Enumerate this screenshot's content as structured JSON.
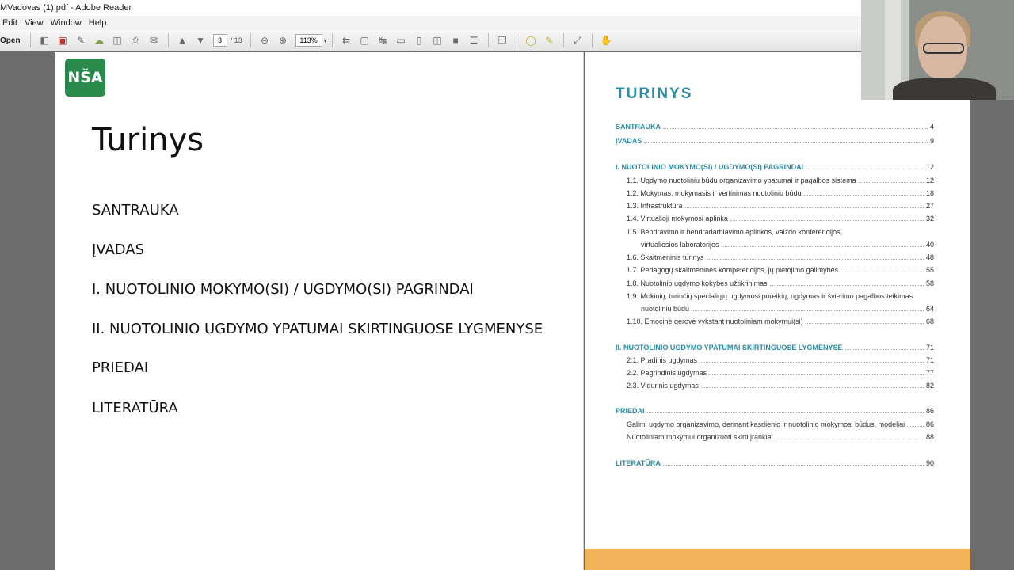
{
  "window": {
    "title": "MVadovas (1).pdf - Adobe Reader"
  },
  "menu": [
    "Edit",
    "View",
    "Window",
    "Help"
  ],
  "toolbar": {
    "open_label": "Open",
    "current_page": "3",
    "total_pages": "/ 13",
    "zoom": "113%"
  },
  "slide": {
    "logo_text": "NŠA",
    "title": "Turinys",
    "items": [
      "SANTRAUKA",
      "ĮVADAS",
      "I. NUOTOLINIO MOKYMO(SI) / UGDYMO(SI) PAGRINDAI",
      "II. NUOTOLINIO UGDYMO YPATUMAI SKIRTINGUOSE LYGMENYSE",
      "PRIEDAI",
      "LITERATŪRA"
    ]
  },
  "toc": {
    "heading": "TURINYS",
    "rows": [
      {
        "text": "SANTRAUKA",
        "page": "4"
      },
      {
        "text": "ĮVADAS",
        "page": "9"
      },
      {
        "text": "I. NUOTOLINIO MOKYMO(SI) / UGDYMO(SI) PAGRINDAI",
        "page": "12"
      },
      {
        "text": "1.1. Ugdymo nuotoliniu būdu organizavimo ypatumai ir pagalbos sistema",
        "page": "12"
      },
      {
        "text": "1.2. Mokymas, mokymasis ir vertinimas nuotoliniu būdu",
        "page": "18"
      },
      {
        "text": "1.3. Infrastruktūra",
        "page": "27"
      },
      {
        "text": "1.4. Virtualioji mokymosi aplinka",
        "page": "32"
      },
      {
        "text": "1.5. Bendravimo ir bendradarbiavimo aplinkos, vaizdo konferencijos,",
        "page": ""
      },
      {
        "text": "virtualiosios laboratorijos",
        "page": "40"
      },
      {
        "text": "1.6. Skaitmeninis turinys",
        "page": "48"
      },
      {
        "text": "1.7. Pedagogų skaitmeninės kompetencijos, jų plėtojimo galimybės",
        "page": "55"
      },
      {
        "text": "1.8. Nuotolinio ugdymo kokybės užtikrinimas",
        "page": "58"
      },
      {
        "text": "1.9. Mokinių, turinčių specialiųjų ugdymosi poreikių, ugdymas ir švietimo pagalbos teikimas",
        "page": ""
      },
      {
        "text": "nuotoliniu būdu",
        "page": "64"
      },
      {
        "text": "1.10. Emocinė gerovė vykstant nuotoliniam mokymui(si)",
        "page": "68"
      },
      {
        "text": "II. NUOTOLINIO UGDYMO YPATUMAI SKIRTINGUOSE LYGMENYSE",
        "page": "71"
      },
      {
        "text": "2.1. Pradinis ugdymas",
        "page": "71"
      },
      {
        "text": "2.2. Pagrindinis ugdymas",
        "page": "77"
      },
      {
        "text": "2.3. Vidurinis ugdymas",
        "page": "82"
      },
      {
        "text": "PRIEDAI",
        "page": "86"
      },
      {
        "text": "Galimi ugdymo organizavimo, derinant kasdienio ir nuotolinio mokymosi būdus, modeliai",
        "page": "86"
      },
      {
        "text": "Nuotoliniam mokymui organizuoti skirti įrankiai",
        "page": "88"
      },
      {
        "text": "LITERATŪRA",
        "page": "90"
      }
    ]
  },
  "colors": {
    "toc_accent": "#2b8ca5",
    "footer_band": "#f2b45a",
    "logo_green": "#2a8a4b"
  }
}
